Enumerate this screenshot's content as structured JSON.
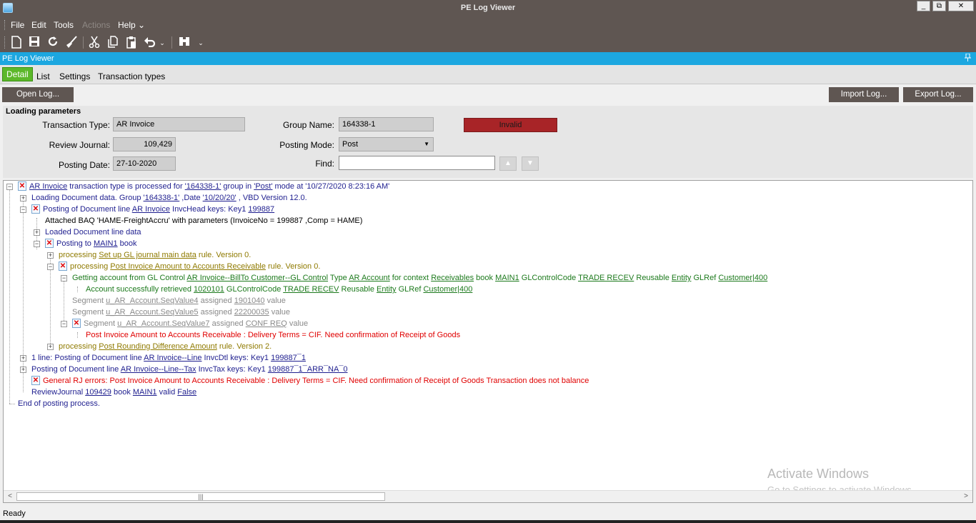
{
  "window": {
    "title": "PE Log Viewer",
    "min": "_",
    "restore": "⧉",
    "close": "✕"
  },
  "menu": {
    "file": "File",
    "edit": "Edit",
    "tools": "Tools",
    "actions": "Actions",
    "help": "Help ⌄"
  },
  "toolbar": {
    "icons": [
      "new-document-icon",
      "save-icon",
      "refresh-icon",
      "broom-icon",
      "cut-icon",
      "copy-icon",
      "paste-icon",
      "undo-icon",
      "binoculars-icon"
    ]
  },
  "pane": {
    "title": "PE Log Viewer",
    "pin": "📌"
  },
  "tabs": {
    "detail": "Detail",
    "list": "List",
    "settings": "Settings",
    "transaction_types": "Transaction types"
  },
  "actions": {
    "open_log": "Open Log...",
    "import_log": "Import Log...",
    "export_log": "Export Log..."
  },
  "params": {
    "header": "Loading parameters",
    "transaction_type_label": "Transaction Type:",
    "transaction_type_value": "AR Invoice",
    "review_journal_label": "Review Journal:",
    "review_journal_value": "109,429",
    "posting_date_label": "Posting Date:",
    "posting_date_value": "27-10-2020",
    "group_name_label": "Group Name:",
    "group_name_value": "164338-1",
    "posting_mode_label": "Posting Mode:",
    "posting_mode_value": "Post",
    "find_label": "Find:",
    "find_value": "",
    "status": "Invalid"
  },
  "tree": {
    "r1": {
      "a": "AR Invoice",
      "b": " transaction type is processed for ",
      "c": "'164338-1'",
      "d": " group in ",
      "e": "'Post'",
      "f": " mode  at '10/27/2020 8:23:16 AM'"
    },
    "r2": {
      "a": "Loading Document data. Group ",
      "b": "'164338-1'",
      "c": " ,Date ",
      "d": "'10/20/20'",
      "e": " , VBD Version 12.0."
    },
    "r3": {
      "a": "Posting of Document line ",
      "b": "AR Invoice",
      "c": "  InvcHead keys:  Key1 ",
      "d": "199887"
    },
    "r4": {
      "a": "Attached BAQ 'HAME-FreightAccru' with parameters (InvoiceNo = 199887 ,Comp = HAME)"
    },
    "r5": {
      "a": "Loaded Document line data"
    },
    "r6": {
      "a": "Posting to ",
      "b": "MAIN1",
      "c": "  book"
    },
    "r7": {
      "a": "processing ",
      "b": "Set up GL journal main data",
      "c": "   rule. Version 0."
    },
    "r8": {
      "a": "processing ",
      "b": "Post Invoice Amount to Accounts Receivable",
      "c": "   rule. Version 0."
    },
    "r9": {
      "a": "Getting account from GL Control  ",
      "b": "AR Invoice--BillTo Customer--GL Control",
      "c": "  Type ",
      "d": "AR Account",
      "e": "  for context ",
      "f": "Receivables",
      "g": "  book ",
      "h": "MAIN1",
      "i": "  GLControlCode ",
      "j": "TRADE RECEV",
      "k": "   Reusable ",
      "l": "Entity",
      "m": "  GLRef ",
      "n": "Customer|400"
    },
    "r10": {
      "a": "Account successfully retrieved ",
      "b": "1020101",
      "c": "  GLControlCode ",
      "d": "TRADE RECEV",
      "e": "   Reusable ",
      "f": "Entity",
      "g": "  GLRef ",
      "h": "Customer|400"
    },
    "r11": {
      "a": "Segment  ",
      "b": "u_AR_Account.SeqValue4",
      "c": "   assigned ",
      "d": "1901040",
      "e": "  value"
    },
    "r12": {
      "a": "Segment  ",
      "b": "u_AR_Account.SeqValue5",
      "c": "   assigned ",
      "d": "22200035",
      "e": "  value"
    },
    "r13": {
      "a": "Segment  ",
      "b": "u_AR_Account.SeqValue7",
      "c": "   assigned ",
      "d": "CONF REQ",
      "e": "  value"
    },
    "r14": {
      "a": "Post Invoice Amount to Accounts Receivable : Delivery Terms = CIF. Need confirmation of Receipt of Goods"
    },
    "r15": {
      "a": "processing ",
      "b": "Post Rounding Difference Amount",
      "c": "   rule. Version 2."
    },
    "r16": {
      "a": "1 line: Posting of Document line ",
      "b": "AR Invoice--Line",
      "c": "  InvcDtl keys:  Key1 ",
      "d": "199887¯1"
    },
    "r17": {
      "a": "Posting of Document line ",
      "b": "AR Invoice--Line--Tax",
      "c": "  InvcTax keys:  Key1 ",
      "d": "199887¯1¯ARR¯NA¯0"
    },
    "r18": {
      "a": "General RJ errors: Post Invoice Amount to Accounts Receivable : Delivery Terms = CIF. Need confirmation of Receipt of Goods Transaction does not balance"
    },
    "r19": {
      "a": "ReviewJournal ",
      "b": "109429",
      "c": "  book ",
      "d": "MAIN1",
      "e": "  valid ",
      "f": "False"
    },
    "r20": {
      "a": "End of posting process."
    }
  },
  "scroll": {
    "left": "<",
    "right": ">",
    "grip": "|||"
  },
  "watermark": {
    "line1": "Activate Windows",
    "line2": "Go to Settings to activate Windows."
  },
  "status": {
    "text": "Ready"
  }
}
